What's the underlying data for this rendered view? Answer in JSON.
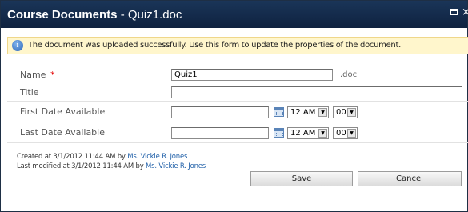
{
  "dialog": {
    "title_bold": "Course Documents",
    "title_rest": " - Quiz1.doc"
  },
  "banner": {
    "message": "The document was uploaded successfully. Use this form to update the properties of the document."
  },
  "form": {
    "name": {
      "label": "Name",
      "required_mark": "*",
      "value": "Quiz1",
      "extension": ".doc"
    },
    "title": {
      "label": "Title",
      "value": ""
    },
    "first_date": {
      "label": "First Date Available",
      "value": "",
      "hour": "12 AM",
      "minute": "00"
    },
    "last_date": {
      "label": "Last Date Available",
      "value": "",
      "hour": "12 AM",
      "minute": "00"
    }
  },
  "meta": {
    "created_prefix": "Created at 3/1/2012 11:44 AM by ",
    "created_by": "Ms. Vickie R. Jones",
    "modified_prefix": "Last modified at 3/1/2012 11:44 AM by ",
    "modified_by": "Ms. Vickie R. Jones"
  },
  "buttons": {
    "save": "Save",
    "cancel": "Cancel"
  }
}
